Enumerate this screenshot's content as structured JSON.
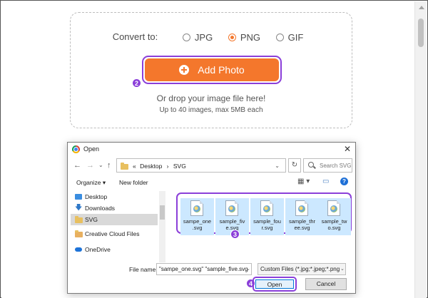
{
  "web": {
    "convert_label": "Convert to:",
    "formats": [
      {
        "label": "JPG",
        "selected": false
      },
      {
        "label": "PNG",
        "selected": true
      },
      {
        "label": "GIF",
        "selected": false
      }
    ],
    "add_photo_label": "Add Photo",
    "drop_text": "Or drop your image file here!",
    "limit_text": "Up to 40 images, max 5MB each",
    "accent": "#f4772c"
  },
  "badges": {
    "step2": "2",
    "step3": "3",
    "step4": "4"
  },
  "dialog": {
    "title": "Open",
    "close_label": "✕",
    "path": {
      "prefix": "«",
      "parts": [
        "Desktop",
        "SVG"
      ],
      "separator": "›"
    },
    "search_placeholder": "Search SVG",
    "toolbar": {
      "organize": "Organize",
      "new_folder": "New folder"
    },
    "sidebar": [
      {
        "label": "Desktop",
        "icon": "desktop-icon"
      },
      {
        "label": "Downloads",
        "icon": "download-icon"
      },
      {
        "label": "SVG",
        "icon": "folder-icon",
        "selected": true
      },
      {
        "label": "Creative Cloud Files",
        "icon": "creative-cloud-icon"
      },
      {
        "label": "OneDrive",
        "icon": "onedrive-icon"
      }
    ],
    "files": [
      {
        "name_line1": "sampe_one",
        "name_line2": ".svg"
      },
      {
        "name_line1": "sample_fiv",
        "name_line2": "e.svg"
      },
      {
        "name_line1": "sample_fou",
        "name_line2": "r.svg"
      },
      {
        "name_line1": "sample_thr",
        "name_line2": "ee.svg"
      },
      {
        "name_line1": "sample_tw",
        "name_line2": "o.svg"
      }
    ],
    "file_name_label": "File name:",
    "file_name_value": "\"sampe_one.svg\" \"sample_five.svg",
    "file_type_value": "Custom Files (*.jpg;*.jpeg;*.png",
    "open_label": "Open",
    "cancel_label": "Cancel",
    "highlight_color": "#8b3fd9"
  }
}
